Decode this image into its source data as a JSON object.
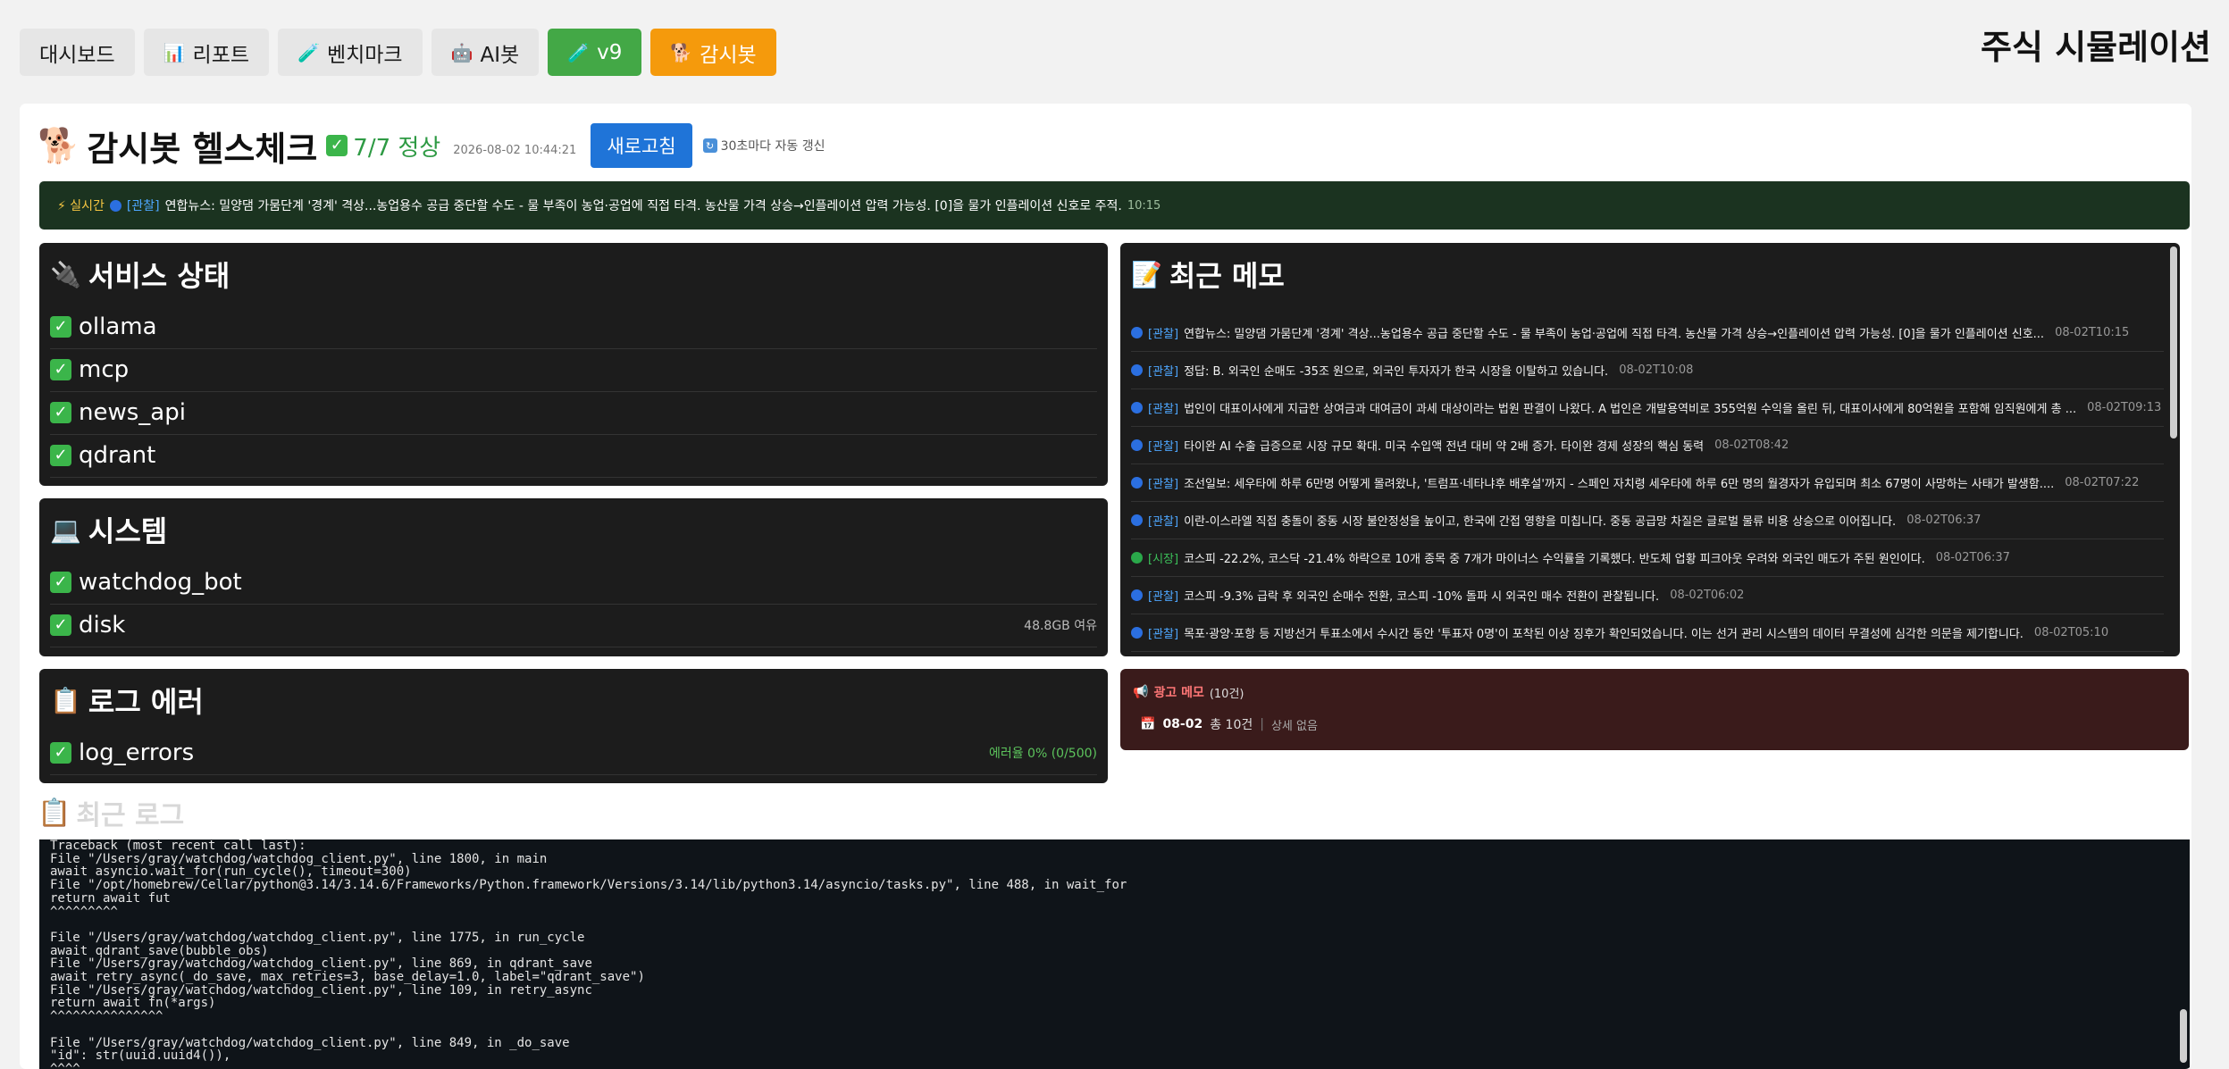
{
  "nav": {
    "items": [
      {
        "label": "대시보드",
        "icon": ""
      },
      {
        "label": "리포트",
        "icon": "📊"
      },
      {
        "label": "벤치마크",
        "icon": "🧪"
      },
      {
        "label": "AI봇",
        "icon": "🤖"
      },
      {
        "label": "v9",
        "icon": "🧪"
      },
      {
        "label": "감시봇",
        "icon": "🐕"
      }
    ],
    "app_title": "주식 시뮬레이션"
  },
  "healthcheck": {
    "icon": "🐕",
    "title": "감시봇 헬스체크",
    "status": "7/7 정상",
    "timestamp": "2026-08-02 10:44:21",
    "refresh_label": "새로고침",
    "auto_refresh": "30초마다 자동 갱신"
  },
  "ticker": {
    "live_label": "⚡ 실시간",
    "tag": "[관찰]",
    "text": "연합뉴스: 밀양댐 가뭄단계 '경계' 격상...농업용수 공급 중단할 수도 - 물 부족이 농업·공업에 직접 타격. 농산물 가격 상승→인플레이션 압력 가능성. [0]을 물가 인플레이션 신호로 주적.",
    "time": "10:15"
  },
  "services": {
    "icon": "🔌",
    "title": "서비스 상태",
    "items": [
      {
        "name": "ollama"
      },
      {
        "name": "mcp"
      },
      {
        "name": "news_api"
      },
      {
        "name": "qdrant"
      }
    ]
  },
  "system": {
    "icon": "💻",
    "title": "시스템",
    "items": [
      {
        "name": "watchdog_bot",
        "meta": ""
      },
      {
        "name": "disk",
        "meta": "48.8GB 여유"
      }
    ]
  },
  "log_errors": {
    "icon": "📋",
    "title": "로그 에러",
    "items": [
      {
        "name": "log_errors",
        "meta": "에러율 0% (0/500)"
      }
    ]
  },
  "memos": {
    "icon": "📝",
    "title": "최근 메모",
    "items": [
      {
        "tag": "[관찰]",
        "type": "obs",
        "text": "연합뉴스: 밀양댐 가뭄단계 '경계' 격상...농업용수 공급 중단할 수도 - 물 부족이 농업·공업에 직접 타격. 농산물 가격 상승→인플레이션 압력 가능성. [0]을 물가 인플레이션 신호...",
        "time": "08-02T10:15"
      },
      {
        "tag": "[관찰]",
        "type": "obs",
        "text": "정답: B. 외국인 순매도 -35조 원으로, 외국인 투자자가 한국 시장을 이탈하고 있습니다.",
        "time": "08-02T10:08"
      },
      {
        "tag": "[관찰]",
        "type": "obs",
        "text": "법인이 대표이사에게 지급한 상여금과 대여금이 과세 대상이라는 법원 판결이 나왔다. A 법인은 개발용역비로 355억원 수익을 올린 뒤, 대표이사에게 80억원을 포함해 임직원에게 총 ...",
        "time": "08-02T09:13"
      },
      {
        "tag": "[관찰]",
        "type": "obs",
        "text": "타이완 AI 수출 급증으로 시장 규모 확대. 미국 수입액 전년 대비 약 2배 증가. 타이완 경제 성장의 핵심 동력",
        "time": "08-02T08:42"
      },
      {
        "tag": "[관찰]",
        "type": "obs",
        "text": "조선일보: 세우타에 하루 6만명 어떻게 몰려왔나, '트럼프·네타냐후 배후설'까지 - 스페인 자치령 세우타에 하루 6만 명의 월경자가 유입되며 최소 67명이 사망하는 사태가 발생함....",
        "time": "08-02T07:22"
      },
      {
        "tag": "[관찰]",
        "type": "obs",
        "text": "이란-이스라엘 직접 충돌이 중동 시장 불안정성을 높이고, 한국에 간접 영향을 미칩니다. 중동 공급망 차질은 글로벌 물류 비용 상승으로 이어집니다.",
        "time": "08-02T06:37"
      },
      {
        "tag": "[시장]",
        "type": "market",
        "text": "코스피 -22.2%, 코스닥 -21.4% 하락으로 10개 종목 중 7개가 마이너스 수익률을 기록했다. 반도체 업황 피크아웃 우려와 외국인 매도가 주된 원인이다.",
        "time": "08-02T06:37"
      },
      {
        "tag": "[관찰]",
        "type": "obs",
        "text": "코스피 -9.3% 급락 후 외국인 순매수 전환, 코스피 -10% 돌파 시 외국인 매수 전환이 관찰됩니다.",
        "time": "08-02T06:02"
      },
      {
        "tag": "[관찰]",
        "type": "obs",
        "text": "목포·광양·포항 등 지방선거 투표소에서 수시간 동안 '투표자 0명'이 포착된 이상 징후가 확인되었습니다. 이는 선거 관리 시스템의 데이터 무결성에 심각한 의문을 제기합니다.",
        "time": "08-02T05:10"
      }
    ]
  },
  "ad_memo": {
    "icon": "📢",
    "title": "광고 메모",
    "count": "(10건)",
    "date": "08-02",
    "total": "총 10건",
    "detail": "상세 없음"
  },
  "recent_log": {
    "icon": "📋",
    "title": "최근 로그",
    "text": "Traceback (most recent call last):\nFile \"/Users/gray/watchdog/watchdog_client.py\", line 1800, in main\nawait asyncio.wait_for(run_cycle(), timeout=300)\nFile \"/opt/homebrew/Cellar/python@3.14/3.14.6/Frameworks/Python.framework/Versions/3.14/lib/python3.14/asyncio/tasks.py\", line 488, in wait_for\nreturn await fut\n^^^^^^^^^\n\nFile \"/Users/gray/watchdog/watchdog_client.py\", line 1775, in run_cycle\nawait qdrant_save(bubble_obs)\nFile \"/Users/gray/watchdog/watchdog_client.py\", line 869, in qdrant_save\nawait retry_async(_do_save, max_retries=3, base_delay=1.0, label=\"qdrant_save\")\nFile \"/Users/gray/watchdog/watchdog_client.py\", line 109, in retry_async\nreturn await fn(*args)\n^^^^^^^^^^^^^^^\n\nFile \"/Users/gray/watchdog/watchdog_client.py\", line 849, in _do_save\n\"id\": str(uuid.uuid4()),\n^^^^\n\nNameError: name 'uuid' is not defined. Did you forget to import 'uuid'?"
  },
  "colors": {
    "ok_green": "#3bb54a",
    "refresh_blue": "#1f74d8",
    "nav_green": "#43a846",
    "nav_orange": "#f59a0c",
    "panel_dark": "#1c1c1c",
    "ad_panel": "#3a1b1b"
  }
}
